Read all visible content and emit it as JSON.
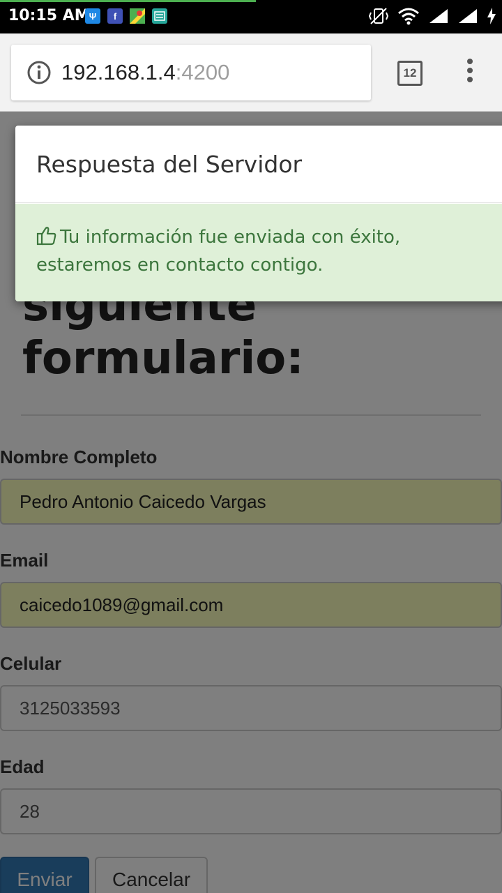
{
  "status_bar": {
    "time": "10:15 AM",
    "app_icons": [
      "trident-icon",
      "document-icon",
      "maps-icon",
      "inbox-icon"
    ],
    "system_icons": [
      "vibrate-off-icon",
      "wifi-icon",
      "signal-icon",
      "signal-icon",
      "charging-icon"
    ]
  },
  "browser": {
    "url_host": "192.168.1.4",
    "url_port": ":4200",
    "tab_count": "12",
    "load_progress": 0.51
  },
  "page": {
    "heading_lines": [
      "siguiente",
      "formulario:"
    ],
    "fields": [
      {
        "label": "Nombre Completo",
        "value": "Pedro Antonio Caicedo Vargas",
        "autofilled": true
      },
      {
        "label": "Email",
        "value": "caicedo1089@gmail.com",
        "autofilled": true
      },
      {
        "label": "Celular",
        "value": "3125033593",
        "autofilled": false
      },
      {
        "label": "Edad",
        "value": "28",
        "autofilled": false
      }
    ],
    "submit_label": "Enviar",
    "cancel_label": "Cancelar"
  },
  "modal": {
    "title": "Respuesta del Servidor",
    "message": "Tu información fue enviada con éxito, estaremos en contacto contigo."
  },
  "colors": {
    "success_bg": "#dff0d8",
    "success_text": "#3c763d",
    "primary_button": "#337ab7",
    "autofill_bg": "#faffbd"
  }
}
